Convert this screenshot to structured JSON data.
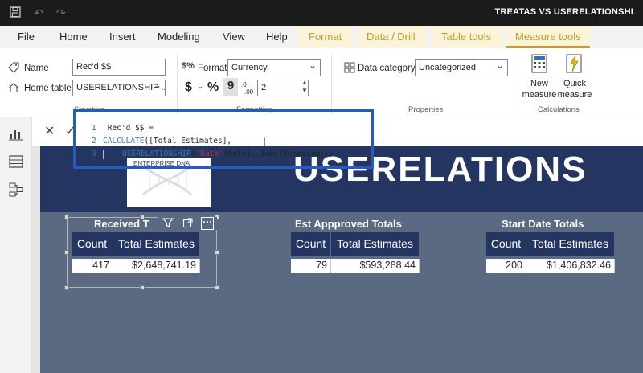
{
  "window": {
    "title": "TREATAS VS USERELATIONSHI"
  },
  "tabs": {
    "file": "File",
    "home": "Home",
    "insert": "Insert",
    "modeling": "Modeling",
    "view": "View",
    "help": "Help",
    "format": "Format",
    "data_drill": "Data / Drill",
    "table_tools": "Table tools",
    "measure_tools": "Measure tools"
  },
  "ribbon": {
    "name_label": "Name",
    "name_value": "Rec'd $$",
    "home_table_label": "Home table",
    "home_table_value": "USERELATIONSHIP ...",
    "structure_label": "Structure",
    "format_label": "Format",
    "format_value": "Currency",
    "dollar": "$",
    "percent": "%",
    "comma": "9",
    "decimals_value": "2",
    "formatting_label": "Formatting",
    "data_category_label": "Data category",
    "data_category_value": "Uncategorized",
    "properties_label": "Properties",
    "new_measure_line1": "New",
    "new_measure_line2": "measure",
    "quick_measure_line1": "Quick",
    "quick_measure_line2": "measure",
    "calculations_label": "Calculations"
  },
  "formula": {
    "cancel": "✕",
    "commit": "✓",
    "lines": [
      {
        "num": "1",
        "text": "Rec'd $$ ="
      },
      {
        "num": "2",
        "fn": "CALCULATE",
        "text": "([Total Estimates],"
      },
      {
        "num": "3",
        "fn": "USERELATIONSHIP",
        "text_pre": "(",
        "str": "'Date'",
        "text": "[Date], Jobs[Received]))"
      }
    ]
  },
  "report": {
    "banner_text": "USERELATIONS",
    "logo_text": "ENTERPRISE DNA",
    "visuals": [
      {
        "title": "Received T",
        "headers": [
          "Count",
          "Total Estimates"
        ],
        "row": [
          "417",
          "$2,648,741.19"
        ]
      },
      {
        "title": "Est Appproved Totals",
        "headers": [
          "Count",
          "Total Estimates"
        ],
        "row": [
          "79",
          "$593,288.44"
        ]
      },
      {
        "title": "Start Date Totals",
        "headers": [
          "Count",
          "Total Estimates"
        ],
        "row": [
          "200",
          "$1,406,832.46"
        ]
      }
    ]
  },
  "colors": {
    "accent": "#c29c27",
    "highlight": "#1d5fc7",
    "header_navy": "#233560",
    "report_bg": "#5b6a83"
  }
}
